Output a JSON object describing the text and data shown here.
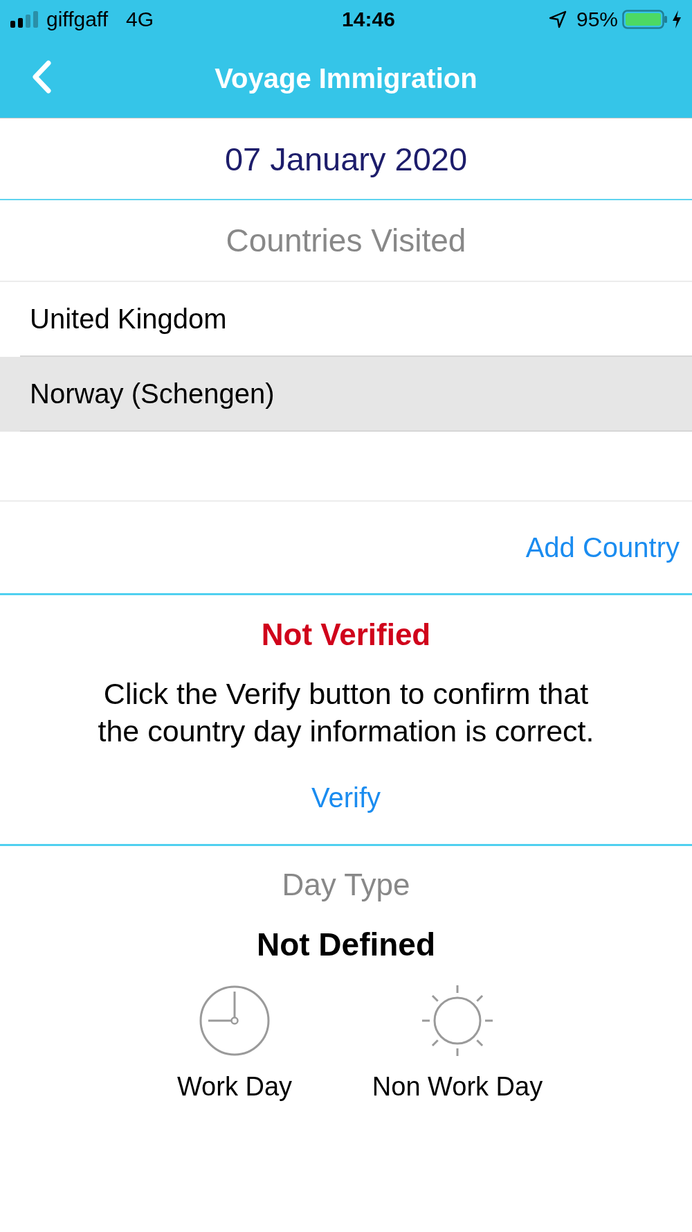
{
  "status_bar": {
    "carrier": "giffgaff",
    "network": "4G",
    "time": "14:46",
    "battery_percent": "95%"
  },
  "nav_bar": {
    "title": "Voyage Immigration"
  },
  "date": "07 January 2020",
  "countries": {
    "heading": "Countries Visited",
    "items": [
      {
        "name": "United Kingdom",
        "selected": false
      },
      {
        "name": "Norway (Schengen)",
        "selected": true
      }
    ],
    "add_button": "Add Country"
  },
  "verification": {
    "verified": false,
    "status": "Not Verified",
    "message": "Click the Verify button to confirm that the country day information is correct.",
    "button": "Verify"
  },
  "day_type": {
    "heading": "Day Type",
    "value": "Not Defined",
    "options": [
      {
        "kind": "work",
        "label": "Work Day",
        "selected": false
      },
      {
        "kind": "non_work",
        "label": "Non Work Day",
        "selected": false
      }
    ]
  }
}
